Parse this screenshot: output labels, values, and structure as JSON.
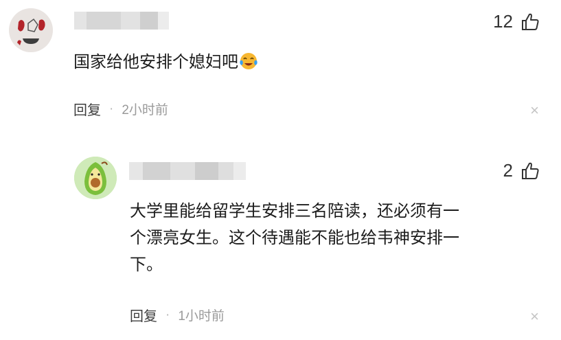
{
  "comments": [
    {
      "avatar": "avatar-icon",
      "likes": "12",
      "content": "国家给他安排个媳妇吧",
      "emoji": "laughing-crying-emoji",
      "reply_label": "回复",
      "separator": "·",
      "time": "2小时前",
      "close_label": "×"
    },
    {
      "avatar": "avocado-avatar-icon",
      "likes": "2",
      "content_lines": [
        "大学里能给留学生安排三名陪读，还必须有一",
        "个漂亮女生。这个待遇能不能也给韦神安排一",
        "下。"
      ],
      "reply_label": "回复",
      "separator": "·",
      "time": "1小时前",
      "close_label": "×"
    }
  ],
  "colors": {
    "text": "#1c1c1c",
    "meta": "#9a9a9a",
    "blur": "#d6d6d6"
  }
}
